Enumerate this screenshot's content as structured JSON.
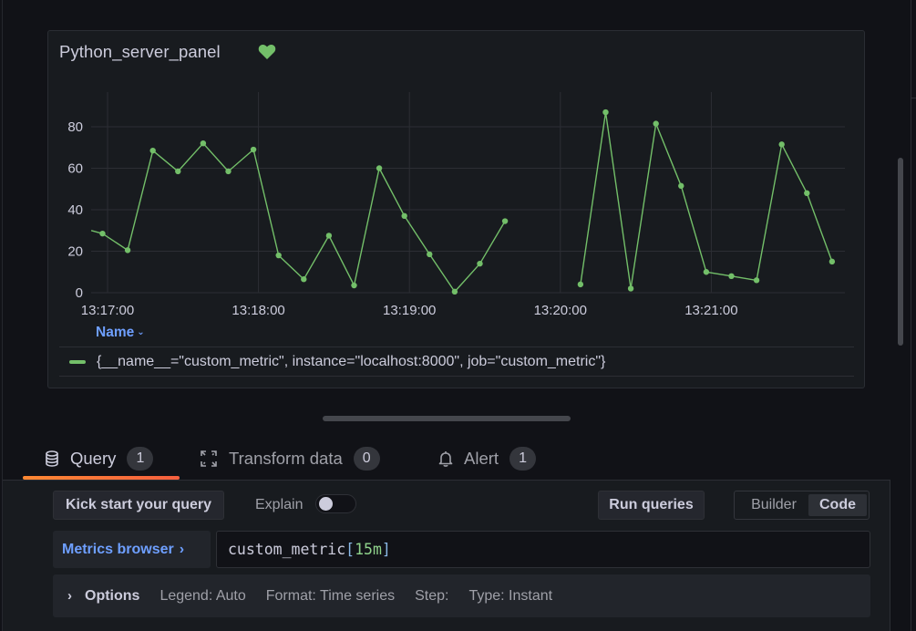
{
  "panel": {
    "title": "Python_server_panel",
    "status_icon": "heart-icon",
    "legend": {
      "header": "Name",
      "header_icon": "chevron-down-icon",
      "series_label": "{__name__=\"custom_metric\", instance=\"localhost:8000\", job=\"custom_metric\"}",
      "series_color": "#73bf69"
    }
  },
  "chart_data": {
    "type": "line",
    "title": "Python_server_panel",
    "xlabel": "",
    "ylabel": "",
    "x_ticks": [
      "13:17:00",
      "13:18:00",
      "13:19:00",
      "13:20:00",
      "13:21:00"
    ],
    "y_ticks": [
      "0",
      "20",
      "40",
      "60",
      "80"
    ],
    "ylim": [
      0,
      90
    ],
    "grid": true,
    "legend_position": "bottom",
    "x_unit": "seconds after 13:17:00",
    "series": [
      {
        "name": "{__name__=\"custom_metric\", instance=\"localhost:8000\", job=\"custom_metric\"}",
        "color": "#73bf69",
        "segments": [
          {
            "x": [
              -6.5,
              -2,
              8,
              18,
              28,
              38,
              48,
              58,
              68,
              78,
              88,
              98,
              108,
              118,
              128,
              138,
              148,
              158
            ],
            "y": [
              30,
              28.5,
              20.5,
              68.5,
              58.5,
              72,
              58.5,
              69,
              18,
              6.5,
              27.5,
              3.5,
              60,
              37,
              18.5,
              0.5,
              14,
              34.5
            ],
            "markers": [
              false,
              true,
              true,
              true,
              true,
              true,
              true,
              true,
              true,
              true,
              true,
              true,
              true,
              true,
              true,
              true,
              true,
              true
            ]
          },
          {
            "x": [
              188,
              198,
              208,
              218,
              228,
              238,
              248,
              258,
              268,
              278,
              288
            ],
            "y": [
              4,
              87,
              2,
              81.5,
              51.5,
              10,
              8,
              6,
              71.5,
              48,
              15
            ],
            "markers": [
              true,
              true,
              true,
              true,
              true,
              true,
              true,
              true,
              true,
              true,
              true
            ]
          }
        ]
      }
    ]
  },
  "tabs": [
    {
      "label": "Query",
      "count": "1",
      "icon": "database-icon",
      "active": true
    },
    {
      "label": "Transform data",
      "count": "0",
      "icon": "transform-icon",
      "active": false
    },
    {
      "label": "Alert",
      "count": "1",
      "icon": "bell-icon",
      "active": false
    }
  ],
  "query_editor": {
    "kick_start_label": "Kick start your query",
    "explain_label": "Explain",
    "explain_enabled": false,
    "run_queries_label": "Run queries",
    "modes": [
      "Builder",
      "Code"
    ],
    "active_mode": "Code",
    "metrics_browser_label": "Metrics browser",
    "query_parts": {
      "metric": "custom_metric",
      "open": "[",
      "duration": "15m",
      "close": "]"
    },
    "options": {
      "title": "Options",
      "legend": "Legend: Auto",
      "format": "Format: Time series",
      "step": "Step:",
      "type": "Type: Instant"
    }
  },
  "colors": {
    "accent_series": "#73bf69",
    "tab_active_gradient_start": "#ff8833",
    "tab_active_gradient_end": "#f55f3e",
    "link": "#6e9fff"
  }
}
